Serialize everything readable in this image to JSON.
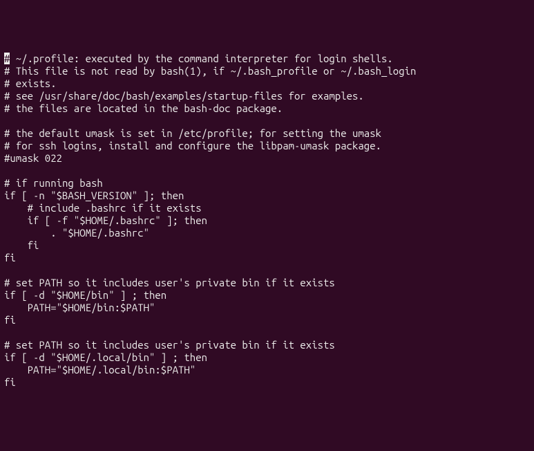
{
  "terminal": {
    "cursor_char": "#",
    "lines": [
      " ~/.profile: executed by the command interpreter for login shells.",
      "# This file is not read by bash(1), if ~/.bash_profile or ~/.bash_login",
      "# exists.",
      "# see /usr/share/doc/bash/examples/startup-files for examples.",
      "# the files are located in the bash-doc package.",
      "",
      "# the default umask is set in /etc/profile; for setting the umask",
      "# for ssh logins, install and configure the libpam-umask package.",
      "#umask 022",
      "",
      "# if running bash",
      "if [ -n \"$BASH_VERSION\" ]; then",
      "    # include .bashrc if it exists",
      "    if [ -f \"$HOME/.bashrc\" ]; then",
      "        . \"$HOME/.bashrc\"",
      "    fi",
      "fi",
      "",
      "# set PATH so it includes user's private bin if it exists",
      "if [ -d \"$HOME/bin\" ] ; then",
      "    PATH=\"$HOME/bin:$PATH\"",
      "fi",
      "",
      "# set PATH so it includes user's private bin if it exists",
      "if [ -d \"$HOME/.local/bin\" ] ; then",
      "    PATH=\"$HOME/.local/bin:$PATH\"",
      "fi"
    ]
  }
}
